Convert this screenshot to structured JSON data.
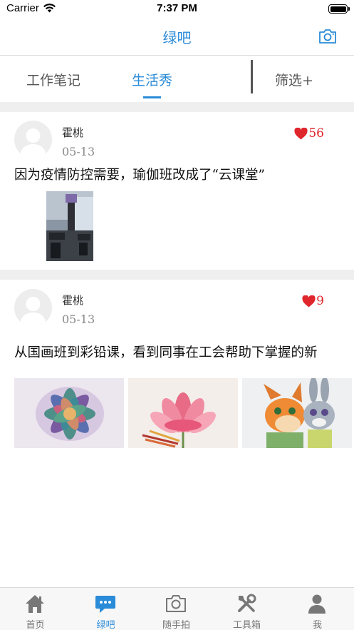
{
  "status_bar": {
    "carrier": "Carrier",
    "time": "7:37 PM"
  },
  "header": {
    "title": "绿吧",
    "right_icon": "camera-icon"
  },
  "tabs": [
    {
      "label": "工作笔记",
      "active": false
    },
    {
      "label": "生活秀",
      "active": true
    },
    {
      "label": "筛选+",
      "active": false
    }
  ],
  "posts": [
    {
      "author": "霍桃",
      "date": "05-13",
      "likes": "56",
      "text": "因为疫情防控需要，瑜伽班改成了“云课堂”",
      "images": [
        "classroom-photo"
      ]
    },
    {
      "author": "霍桃",
      "date": "05-13",
      "likes": "9",
      "text": "从国画班到彩铅课，看到同事在工会帮助下掌握的新",
      "images": [
        "succulent-painting",
        "lotus-drawing",
        "fox-and-rabbit-drawing"
      ]
    }
  ],
  "bottom_nav": [
    {
      "label": "首页",
      "icon": "home-icon",
      "active": false
    },
    {
      "label": "绿吧",
      "icon": "chat-bubble-icon",
      "active": true
    },
    {
      "label": "随手拍",
      "icon": "camera-icon",
      "active": false
    },
    {
      "label": "工具箱",
      "icon": "tools-icon",
      "active": false
    },
    {
      "label": "我",
      "icon": "person-icon",
      "active": false
    }
  ],
  "colors": {
    "accent": "#2a8bd8",
    "like": "#e0262d",
    "separator": "#efefef"
  }
}
